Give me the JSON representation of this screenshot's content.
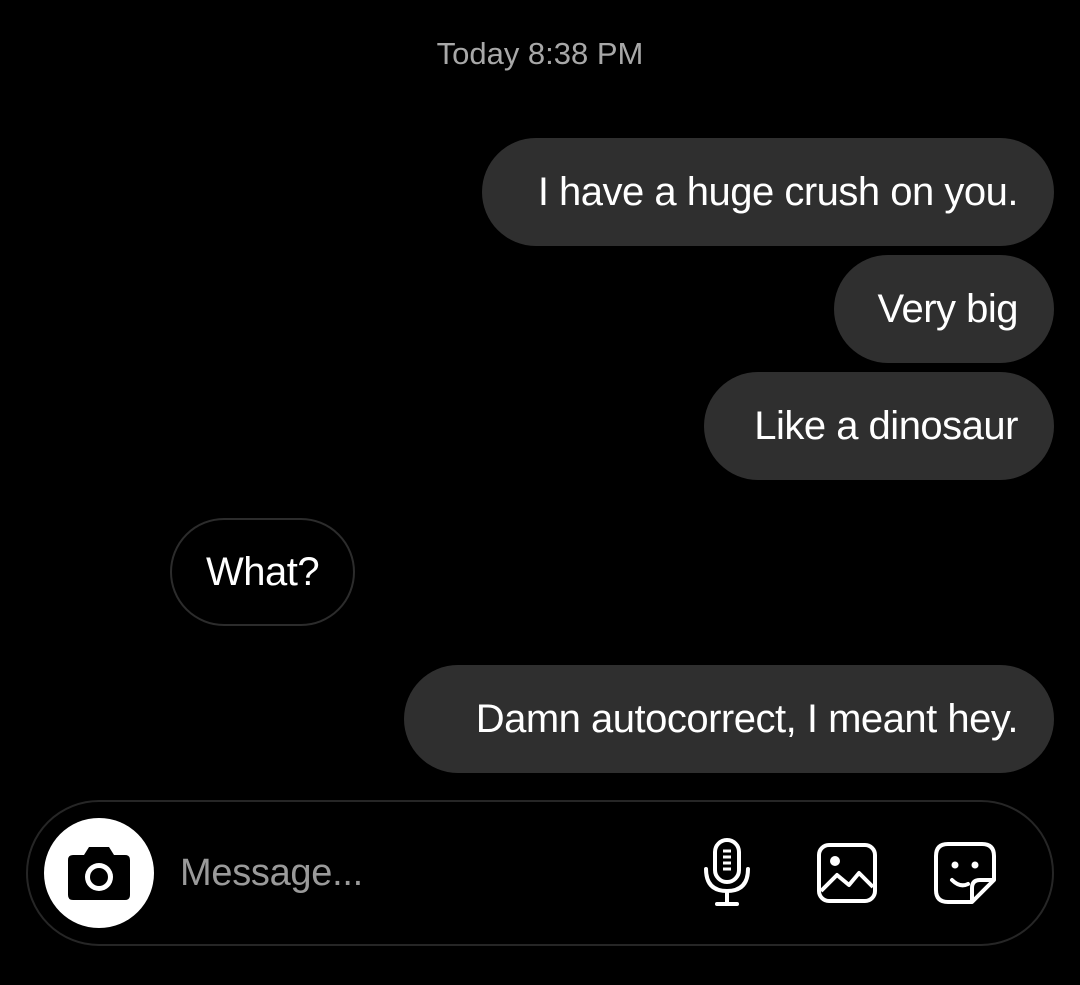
{
  "timestamp": "Today 8:38 PM",
  "messages": [
    {
      "direction": "sent",
      "text": "I have a huge crush on you."
    },
    {
      "direction": "sent",
      "text": "Very big"
    },
    {
      "direction": "sent",
      "text": "Like a dinosaur"
    },
    {
      "direction": "received",
      "text": "What?"
    },
    {
      "direction": "sent",
      "text": "Damn autocorrect, I meant hey."
    }
  ],
  "composer": {
    "placeholder": "Message...",
    "icons": {
      "camera": "camera-icon",
      "mic": "microphone-icon",
      "gallery": "gallery-icon",
      "sticker": "sticker-icon"
    }
  },
  "colors": {
    "background": "#000000",
    "sent_bubble": "#2f2f2f",
    "received_border": "#2c2c2c",
    "timestamp": "#a8a8a8",
    "placeholder": "#9a9a9a"
  }
}
